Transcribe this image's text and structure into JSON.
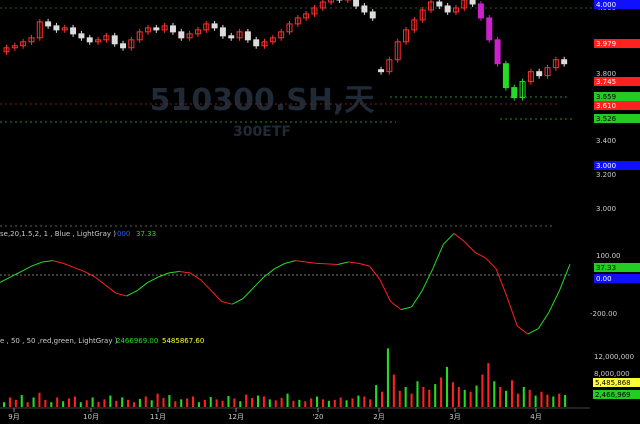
{
  "watermark": {
    "symbol": "510300.SH,天",
    "name": "300ETF"
  },
  "colors": {
    "background": "#000000",
    "up": "#ff3030",
    "down": "#dcdcdc",
    "green": "#22dd22",
    "red": "#ff2020",
    "magenta": "#cc22cc",
    "blue": "#1010ff",
    "yellow": "#ffff33",
    "axis_text": "#cccccc"
  },
  "price_axis": {
    "ticks": [
      "4.000",
      "3.800",
      "3.600",
      "3.400",
      "3.200",
      "3.000"
    ],
    "tags": [
      {
        "text": "3.979",
        "style": "red"
      },
      {
        "text": "3.745",
        "style": "red"
      },
      {
        "text": "3.659",
        "style": "green"
      },
      {
        "text": "3.610",
        "style": "red"
      },
      {
        "text": "3.526",
        "style": "green"
      },
      {
        "text": "3.000",
        "style": "blue"
      }
    ]
  },
  "oscillator": {
    "label": "se,20,1.5,2, 1 , Blue , LightGray )",
    "value_a": "000",
    "value_b": "37.33",
    "ticks": [
      "100.00",
      "-200.00"
    ],
    "tags": [
      {
        "text": "37.33",
        "style": "green"
      },
      {
        "text": "0.00",
        "style": "blue"
      }
    ]
  },
  "volume": {
    "label": "e , 50 , 50 ,red,green, LightGray )",
    "value_a": "2466969.00",
    "value_b": "5485867.60",
    "ticks": [
      "12,000,000",
      "8,000,000"
    ],
    "tags": [
      {
        "text": "5,485,868",
        "style": "yellow"
      },
      {
        "text": "2,466,969",
        "style": "green"
      }
    ]
  },
  "x_axis": {
    "labels": [
      "9月",
      "10月",
      "11月",
      "12月",
      "'20",
      "2月",
      "3月",
      "4月"
    ]
  },
  "chart_data": [
    {
      "type": "line",
      "title": "",
      "series": [
        {
          "values": [
            -30,
            -10,
            10,
            30,
            45,
            50,
            40,
            25,
            10,
            -10,
            -40,
            -70,
            -80,
            -60,
            -30,
            -10,
            5,
            10,
            5,
            -20,
            -60,
            -100,
            -110,
            -90,
            -50,
            -10,
            20,
            40,
            50,
            45,
            40,
            38,
            36,
            45,
            40,
            30,
            -20,
            -100,
            -130,
            -120,
            -60,
            20,
            110,
            150,
            120,
            80,
            60,
            20,
            -80,
            -190,
            -220,
            -200,
            -140,
            -60,
            37
          ]
        }
      ],
      "ylim": [
        -260,
        170
      ]
    },
    {
      "type": "bar",
      "title": "",
      "series": [
        {
          "values": [
            1,
            2,
            1.5,
            2.5,
            1,
            2,
            3,
            1.5,
            1,
            2,
            1.2,
            1.8,
            2.2,
            1,
            1.4,
            2,
            1.1,
            1.6,
            2.4,
            1.3,
            2,
            1.5,
            1,
            1.7,
            2.2,
            1.4,
            2.8,
            1.9,
            2.5,
            1.2,
            1.6,
            1.8,
            2.2,
            1,
            1.5,
            2.1,
            1.6,
            1.3,
            2.3,
            1.8,
            1.2,
            2.6,
            1.9,
            2.4,
            2.2,
            1.6,
            1.4,
            1.9,
            2.8,
            1.3,
            1.5,
            1.2,
            1.8,
            2.2,
            1.6,
            1.3,
            1.5,
            2,
            1.4,
            1.8,
            2.4,
            2.2,
            1.6,
            4.6,
            3.2,
            12.3,
            6.8,
            3.4,
            4.2,
            2.8,
            5.4,
            4.2,
            3.6,
            4.8,
            6.2,
            8.4,
            5.2,
            4.2,
            3.6,
            3.2,
            4.5,
            6.8,
            9.2,
            5.4,
            4.2,
            3.4,
            5.6,
            2.8,
            4.2,
            3.6,
            2.4,
            3.2,
            2.6,
            2.2,
            2.8,
            2.5
          ]
        }
      ]
    }
  ]
}
